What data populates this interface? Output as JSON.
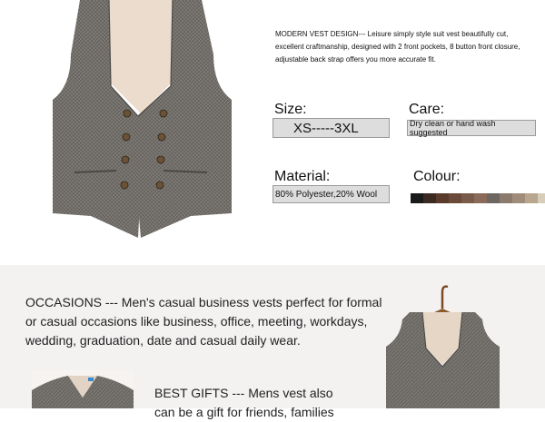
{
  "description": "MODERN VEST DESIGN--- Leisure simply style suit vest beautifully cut, excellent craftmanship, designed with 2 front pockets, 8 button front closure, adjustable back strap offers you more accurate fit.",
  "size": {
    "label": "Size:",
    "value": "XS-----3XL"
  },
  "care": {
    "label": "Care:",
    "value": "Dry clean or hand wash suggested"
  },
  "material": {
    "label": "Material:",
    "value": "80% Polyester,20% Wool"
  },
  "colour": {
    "label": "Colour:",
    "swatches": [
      "#1a1a1a",
      "#3a2a22",
      "#5a3a2a",
      "#6b4a3a",
      "#7a5a48",
      "#8a6a58",
      "#6e6661",
      "#8b7a6e",
      "#a08c7a",
      "#b8a68e",
      "#d8cdb8"
    ]
  },
  "occasions": "OCCASIONS --- Men's casual business vests perfect for formal or casual occasions like business, office, meeting, workdays, wedding, graduation, date and casual daily wear.",
  "gifts": "BEST GIFTS --- Mens vest also can be a gift for friends, families"
}
